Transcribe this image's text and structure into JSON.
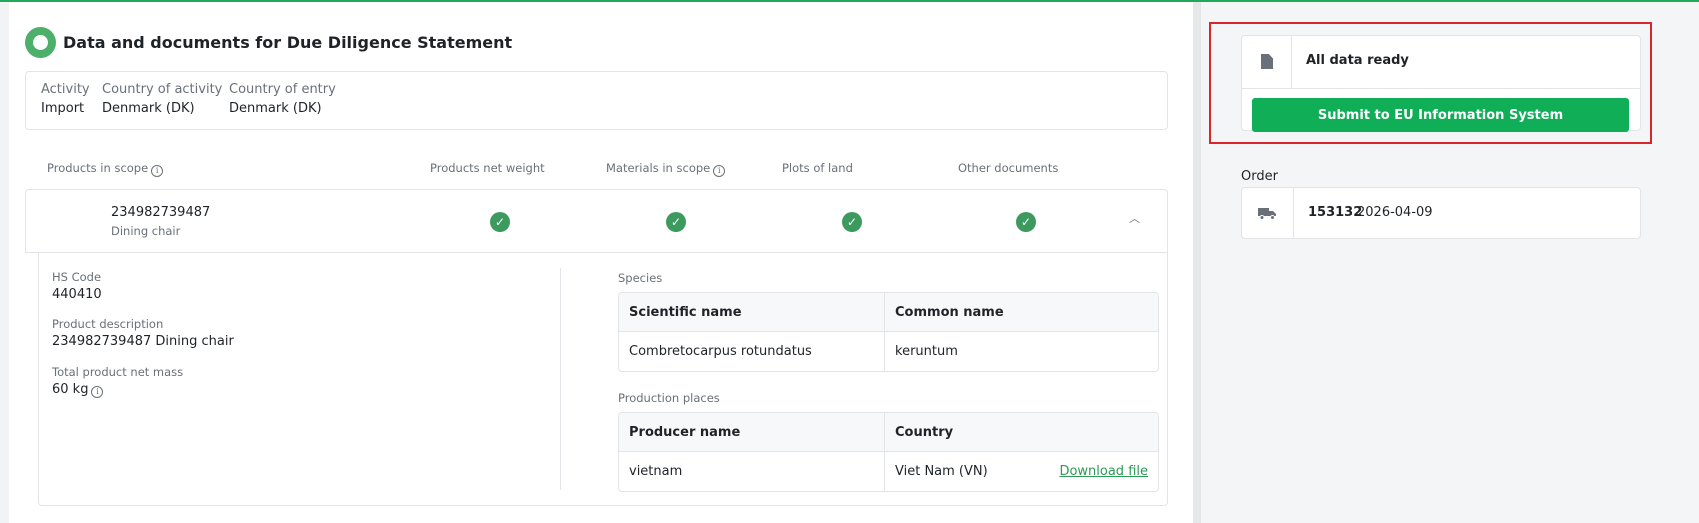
{
  "header": {
    "title": "Data and documents for Due Diligence Statement"
  },
  "activity": {
    "activity_label": "Activity",
    "activity_value": "Import",
    "country_activity_label": "Country of activity",
    "country_activity_value": "Denmark (DK)",
    "country_entry_label": "Country of entry",
    "country_entry_value": "Denmark (DK)"
  },
  "table_header": {
    "products_in_scope": "Products in scope",
    "products_net_weight": "Products net weight",
    "materials_in_scope": "Materials in scope",
    "plots_of_land": "Plots of land",
    "other_documents": "Other documents"
  },
  "product": {
    "id": "234982739487",
    "name": "Dining chair",
    "status_icon": "check-icon",
    "details": {
      "hs_code_label": "HS Code",
      "hs_code": "440410",
      "description_label": "Product description",
      "description": "234982739487 Dining chair",
      "net_mass_label": "Total product net mass",
      "net_mass": "60 kg"
    },
    "species": {
      "label": "Species",
      "headers": [
        "Scientific name",
        "Common name"
      ],
      "rows": [
        [
          "Combretocarpus rotundatus",
          "keruntum"
        ]
      ]
    },
    "production_places": {
      "label": "Production places",
      "headers": [
        "Producer name",
        "Country"
      ],
      "rows": [
        [
          "vietnam",
          "Viet Nam (VN)"
        ]
      ],
      "download_label": "Download file"
    }
  },
  "status": {
    "text": "All data ready",
    "submit_label": "Submit to EU Information System",
    "icon": "document-icon"
  },
  "order": {
    "label": "Order",
    "number": "153132",
    "date": "2026-04-09",
    "icon": "truck-icon"
  },
  "colors": {
    "accent": "#0fae57",
    "check": "#3d9a5e",
    "highlight": "#d9262c",
    "link": "#2f9a57"
  }
}
